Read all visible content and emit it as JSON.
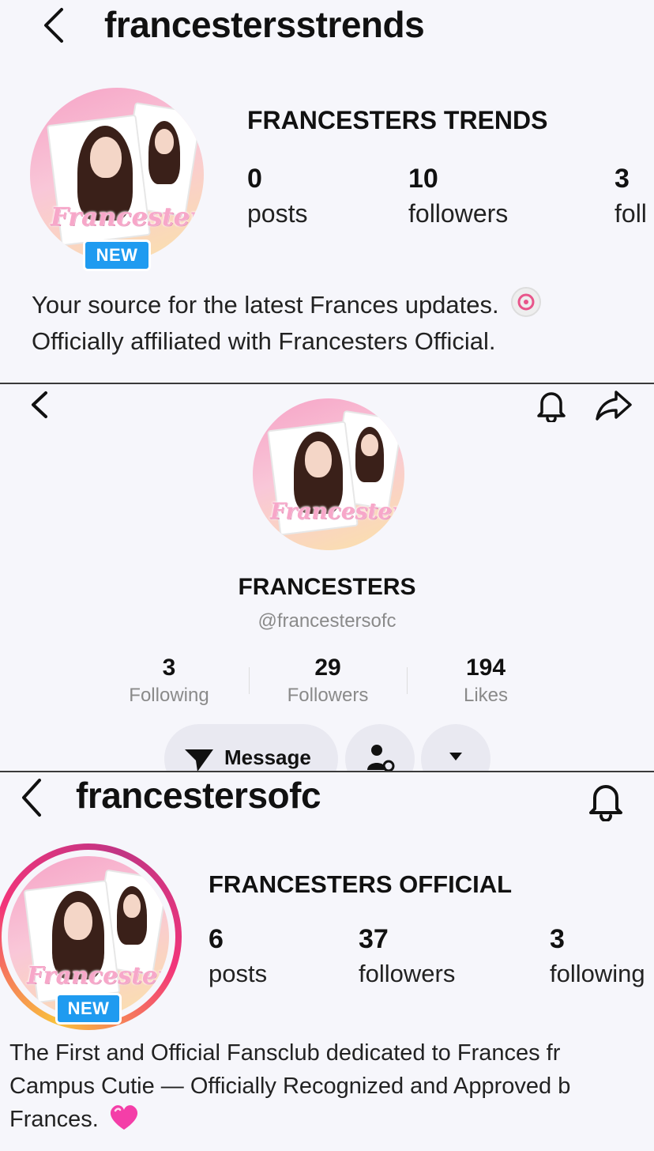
{
  "panel1": {
    "username": "francestersstrends",
    "display_name": "FRANCESTERS TRENDS",
    "badge": "NEW",
    "stats": [
      {
        "value": "0",
        "label": "posts"
      },
      {
        "value": "10",
        "label": "followers"
      },
      {
        "value": "3",
        "label": "foll"
      }
    ],
    "bio_line1": "Your source for the latest Frances updates.",
    "bio_line2": "Officially affiliated with Francesters Official.",
    "bio_emoji_icon": "swirl-emoji-icon",
    "avatar_logo": "Francesters"
  },
  "panel2": {
    "display_name": "FRANCESTERS",
    "handle": "@francestersofc",
    "stats": [
      {
        "value": "3",
        "label": "Following"
      },
      {
        "value": "29",
        "label": "Followers"
      },
      {
        "value": "194",
        "label": "Likes"
      }
    ],
    "message_label": "Message",
    "avatar_logo": "Francesters",
    "icons": [
      "back-icon",
      "bell-icon",
      "share-icon",
      "message-send-icon",
      "person-settings-icon",
      "dropdown-caret-icon"
    ]
  },
  "panel3": {
    "username": "francestersofc",
    "display_name": "FRANCESTERS OFFICIAL",
    "badge": "NEW",
    "stats": [
      {
        "value": "6",
        "label": "posts"
      },
      {
        "value": "37",
        "label": "followers"
      },
      {
        "value": "3",
        "label": "following"
      }
    ],
    "bio_line1": "The First and Official Fansclub dedicated to Frances fr",
    "bio_line2": "Campus Cutie — Officially Recognized and Approved b",
    "bio_line3": "Frances.",
    "bio_emoji_icon": "pink-heart-emoji-icon",
    "avatar_logo": "Francesters"
  },
  "colors": {
    "badge_blue": "#1f9bf0",
    "story_ring": "#f2357a",
    "button_bg": "#e9e9f1"
  }
}
